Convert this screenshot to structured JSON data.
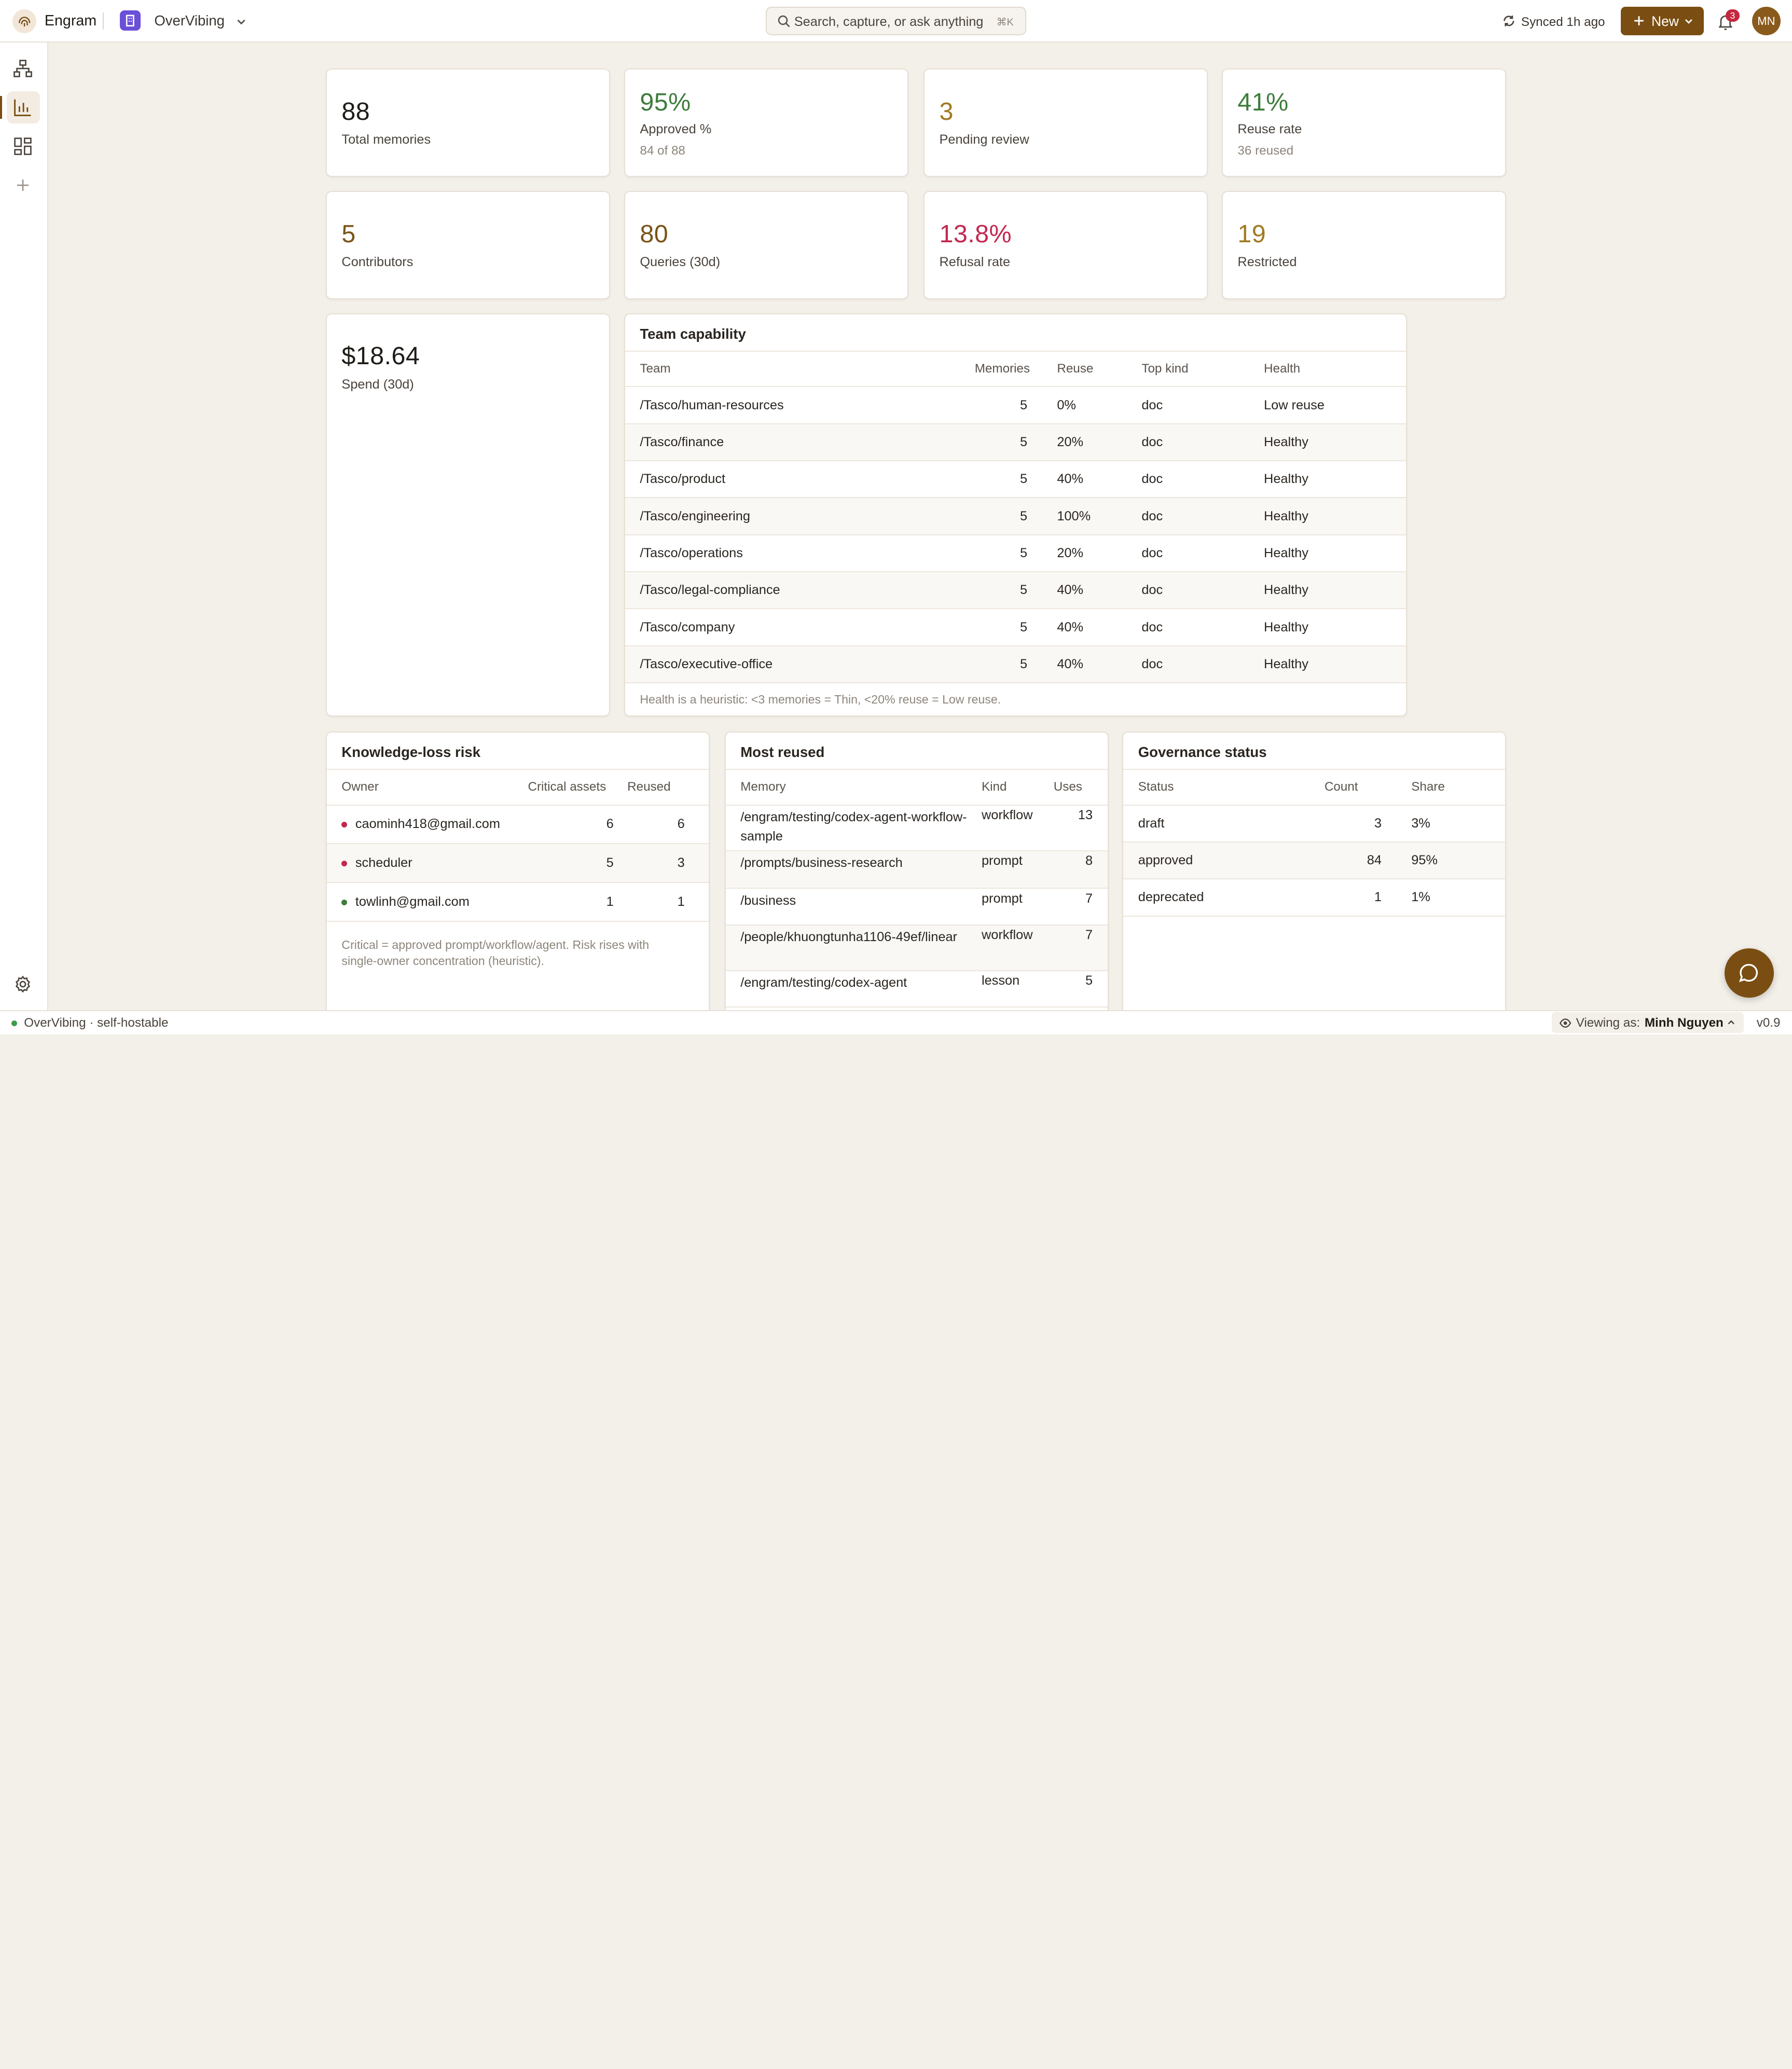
{
  "app": {
    "name": "Engram",
    "workspace": "OverVibing"
  },
  "search": {
    "placeholder": "Search, capture, or ask anything",
    "shortcut": "⌘K"
  },
  "sync": {
    "label": "Synced 1h ago"
  },
  "new_button": {
    "label": "New"
  },
  "notifications": {
    "count": "3"
  },
  "avatar": {
    "initials": "MN"
  },
  "colors": {
    "accent": "#7a4e12",
    "green": "#3e7c3c",
    "amber": "#a17a22",
    "red": "#c3284f",
    "brown": "#7a5416"
  },
  "stats": [
    {
      "value": "88",
      "label": "Total memories",
      "sub": ""
    },
    {
      "value": "95%",
      "label": "Approved %",
      "sub": "84 of 88"
    },
    {
      "value": "3",
      "label": "Pending review",
      "sub": ""
    },
    {
      "value": "41%",
      "label": "Reuse rate",
      "sub": "36 reused"
    },
    {
      "value": "5",
      "label": "Contributors",
      "sub": ""
    },
    {
      "value": "80",
      "label": "Queries (30d)",
      "sub": ""
    },
    {
      "value": "13.8%",
      "label": "Refusal rate",
      "sub": ""
    },
    {
      "value": "19",
      "label": "Restricted",
      "sub": ""
    }
  ],
  "spend": {
    "value": "$18.64",
    "label": "Spend (30d)"
  },
  "team_capability": {
    "title": "Team capability",
    "headers": [
      "Team",
      "Memories",
      "Reuse",
      "Top kind",
      "Health"
    ],
    "rows": [
      {
        "team": "/Tasco/human-resources",
        "memories": "5",
        "reuse": "0%",
        "kind": "doc",
        "health": "Low reuse"
      },
      {
        "team": "/Tasco/finance",
        "memories": "5",
        "reuse": "20%",
        "kind": "doc",
        "health": "Healthy"
      },
      {
        "team": "/Tasco/product",
        "memories": "5",
        "reuse": "40%",
        "kind": "doc",
        "health": "Healthy"
      },
      {
        "team": "/Tasco/engineering",
        "memories": "5",
        "reuse": "100%",
        "kind": "doc",
        "health": "Healthy"
      },
      {
        "team": "/Tasco/operations",
        "memories": "5",
        "reuse": "20%",
        "kind": "doc",
        "health": "Healthy"
      },
      {
        "team": "/Tasco/legal-compliance",
        "memories": "5",
        "reuse": "40%",
        "kind": "doc",
        "health": "Healthy"
      },
      {
        "team": "/Tasco/company",
        "memories": "5",
        "reuse": "40%",
        "kind": "doc",
        "health": "Healthy"
      },
      {
        "team": "/Tasco/executive-office",
        "memories": "5",
        "reuse": "40%",
        "kind": "doc",
        "health": "Healthy"
      }
    ],
    "footnote": "Health is a heuristic: <3 memories = Thin, <20% reuse = Low reuse."
  },
  "knowledge_loss": {
    "title": "Knowledge-loss risk",
    "headers": [
      "Owner",
      "Critical assets",
      "Reused"
    ],
    "rows": [
      {
        "owner": "caominh418@gmail.com",
        "critical": "6",
        "reused": "6",
        "risk": "#c3284f"
      },
      {
        "owner": "scheduler",
        "critical": "5",
        "reused": "3",
        "risk": "#c3284f"
      },
      {
        "owner": "towlinh@gmail.com",
        "critical": "1",
        "reused": "1",
        "risk": "#3e7c3c"
      }
    ],
    "footnote": "Critical = approved prompt/workflow/agent. Risk rises with single-owner concentration (heuristic)."
  },
  "most_reused": {
    "title": "Most reused",
    "headers": [
      "Memory",
      "Kind",
      "Uses"
    ],
    "rows": [
      {
        "memory": "/engram/testing/codex-agent-workflow-sample",
        "kind": "workflow",
        "uses": "13"
      },
      {
        "memory": "/prompts/business-research",
        "kind": "prompt",
        "uses": "8"
      },
      {
        "memory": "/business",
        "kind": "prompt",
        "uses": "7"
      },
      {
        "memory": "/people/khuongtunha1106-49ef/linear",
        "kind": "workflow",
        "uses": "7"
      },
      {
        "memory": "/engram/testing/codex-agent",
        "kind": "lesson",
        "uses": "5"
      }
    ]
  },
  "governance": {
    "title": "Governance status",
    "headers": [
      "Status",
      "Count",
      "Share"
    ],
    "rows": [
      {
        "status": "draft",
        "count": "3",
        "share": "3%"
      },
      {
        "status": "approved",
        "count": "84",
        "share": "95%"
      },
      {
        "status": "deprecated",
        "count": "1",
        "share": "1%"
      }
    ]
  },
  "footer": {
    "left": "OverVibing · self-hostable",
    "viewing_label": "Viewing as:",
    "viewing_user": "Minh Nguyen",
    "version": "v0.9"
  },
  "icons": [
    "fingerprint-icon",
    "building-icon",
    "chevron-down-icon",
    "search-icon",
    "sync-icon",
    "plus-icon",
    "bell-icon",
    "graph-icon",
    "bar-chart-icon",
    "dashboard-icon",
    "add-icon",
    "settings-icon",
    "chat-icon",
    "eye-icon",
    "chevron-up-icon"
  ]
}
